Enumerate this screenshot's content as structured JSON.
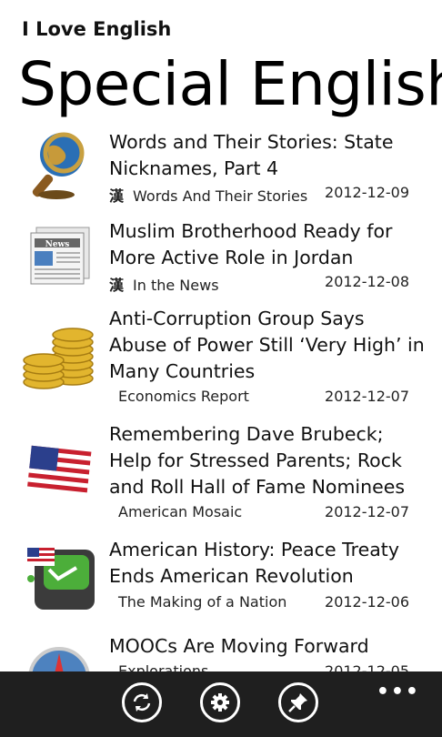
{
  "app": {
    "title": "I Love English"
  },
  "page": {
    "title": "Special English"
  },
  "items": [
    {
      "title": "Words and Their Stories: State Nicknames, Part 4",
      "han": "漢",
      "category": "Words And Their Stories",
      "date": "2012-12-09",
      "icon": "magnifying-glass-globe-icon"
    },
    {
      "title": "Muslim Brotherhood Ready for More Active Role in Jordan",
      "han": "漢",
      "category": "In the News",
      "date": "2012-12-08",
      "icon": "newspaper-icon"
    },
    {
      "title": "Anti-Corruption Group Says Abuse of Power Still ‘Very High’ in Many Countries",
      "han": "",
      "category": "Economics Report",
      "date": "2012-12-07",
      "icon": "gold-coins-icon"
    },
    {
      "title": "Remembering Dave Brubeck; Help for Stressed Parents; Rock and Roll Hall of Fame Nominees",
      "han": "",
      "category": "American Mosaic",
      "date": "2012-12-07",
      "icon": "us-flag-icon"
    },
    {
      "title": "American History: Peace Treaty Ends American Revolution",
      "han": "",
      "category": "The Making of a Nation",
      "date": "2012-12-06",
      "icon": "history-app-icon"
    },
    {
      "title": "MOOCs Are Moving Forward",
      "han": "",
      "category": "Explorations",
      "date": "2012-12-05",
      "icon": "compass-icon"
    }
  ],
  "appbar": {
    "buttons": [
      "refresh-icon",
      "settings-gear-icon",
      "pin-icon"
    ],
    "more": "•••"
  },
  "colors": {
    "background": "#ffffff",
    "appbar": "#1f1f1f",
    "text": "#111111"
  }
}
